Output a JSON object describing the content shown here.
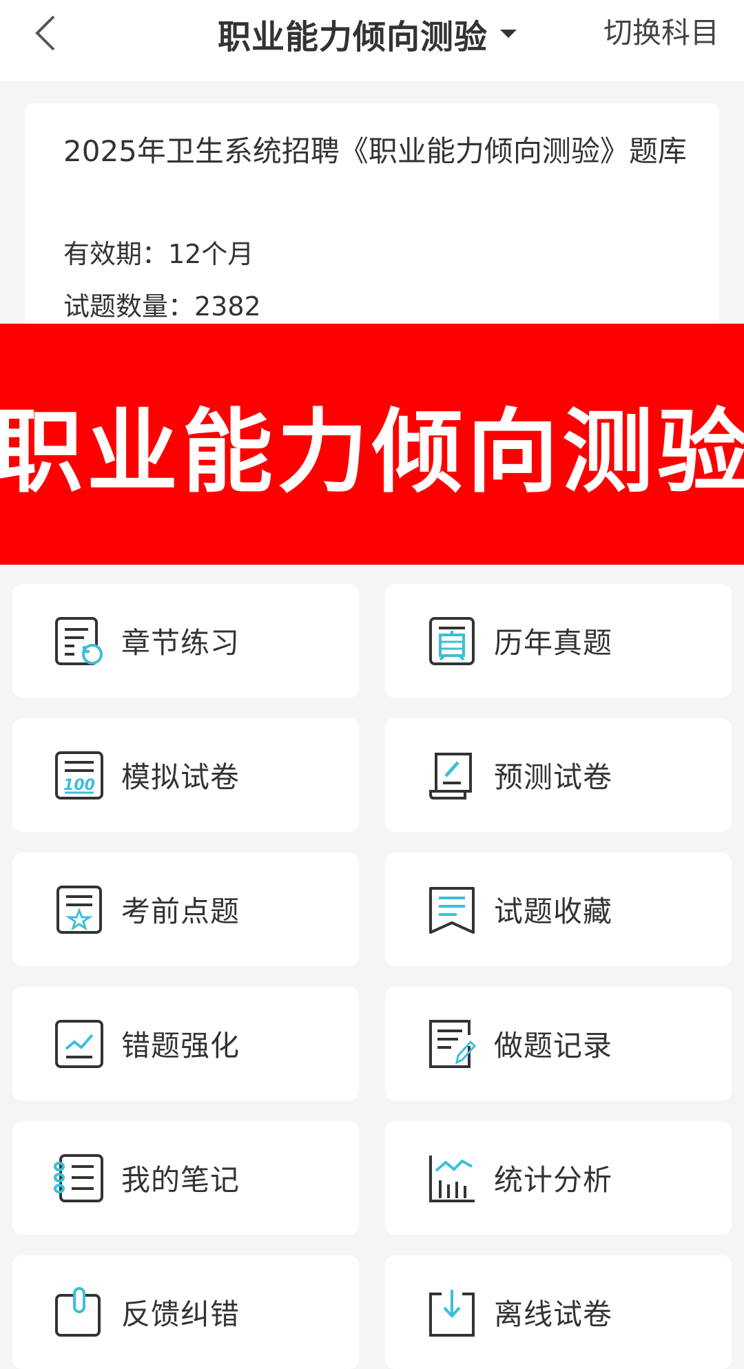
{
  "header": {
    "back_icon": "chevron-left-icon",
    "title": "职业能力倾向测验",
    "switch_label": "切换科目"
  },
  "info": {
    "title": "2025年卫生系统招聘《职业能力倾向测验》题库",
    "validity": "有效期：12个月",
    "count": "试题数量：2382"
  },
  "banner": {
    "text": "职业能力倾向测验",
    "bg_color": "#fe0000"
  },
  "menu": [
    {
      "label": "章节练习",
      "icon": "chapter-practice-icon"
    },
    {
      "label": "历年真题",
      "icon": "past-exam-icon"
    },
    {
      "label": "模拟试卷",
      "icon": "mock-paper-icon"
    },
    {
      "label": "预测试卷",
      "icon": "forecast-paper-icon"
    },
    {
      "label": "考前点题",
      "icon": "key-points-icon"
    },
    {
      "label": "试题收藏",
      "icon": "favorite-questions-icon"
    },
    {
      "label": "错题强化",
      "icon": "wrong-questions-icon"
    },
    {
      "label": "做题记录",
      "icon": "practice-record-icon"
    },
    {
      "label": "我的笔记",
      "icon": "notes-icon"
    },
    {
      "label": "统计分析",
      "icon": "statistics-icon"
    },
    {
      "label": "反馈纠错",
      "icon": "feedback-icon"
    },
    {
      "label": "离线试卷",
      "icon": "offline-paper-icon"
    }
  ],
  "colors": {
    "accent": "#3bbfd8",
    "icon_stroke": "#333333",
    "banner": "#fe0000"
  }
}
